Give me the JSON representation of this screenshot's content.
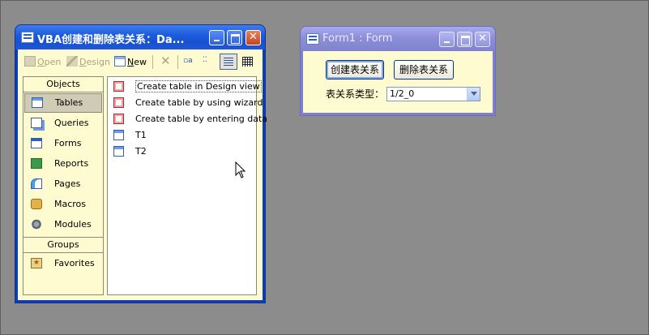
{
  "db_window": {
    "title": "VBA创建和删除表关系：Da...",
    "toolbar": {
      "open": "Open",
      "open_key": "O",
      "open_rest": "pen",
      "design": "Design",
      "design_key": "D",
      "design_rest": "esign",
      "new": "New",
      "new_key": "N",
      "new_rest": "ew"
    },
    "objects_header": "Objects",
    "nav": [
      {
        "label": "Tables",
        "icon": "tables-icon"
      },
      {
        "label": "Queries",
        "icon": "queries-icon"
      },
      {
        "label": "Forms",
        "icon": "forms-icon"
      },
      {
        "label": "Reports",
        "icon": "reports-icon"
      },
      {
        "label": "Pages",
        "icon": "pages-icon"
      },
      {
        "label": "Macros",
        "icon": "macros-icon"
      },
      {
        "label": "Modules",
        "icon": "modules-icon"
      }
    ],
    "groups_header": "Groups",
    "groups": [
      {
        "label": "Favorites",
        "icon": "favorites-icon"
      }
    ],
    "items": [
      {
        "label": "Create table in Design view",
        "icon": "wizard-icon"
      },
      {
        "label": "Create table by using wizard",
        "icon": "wizard-icon"
      },
      {
        "label": "Create table by entering data",
        "icon": "wizard-icon"
      },
      {
        "label": "T1",
        "icon": "table-icon"
      },
      {
        "label": "T2",
        "icon": "table-icon"
      }
    ]
  },
  "form_window": {
    "title": "Form1 : Form",
    "create_button": "创建表关系",
    "delete_button": "删除表关系",
    "type_label": "表关系类型：",
    "type_value": "1/2_0"
  },
  "colors": {
    "desktop": "#8c8c8c",
    "titlebar": "#1c5ddd",
    "panel": "#fffbd0",
    "inactive_title": "#8d8ed6"
  }
}
